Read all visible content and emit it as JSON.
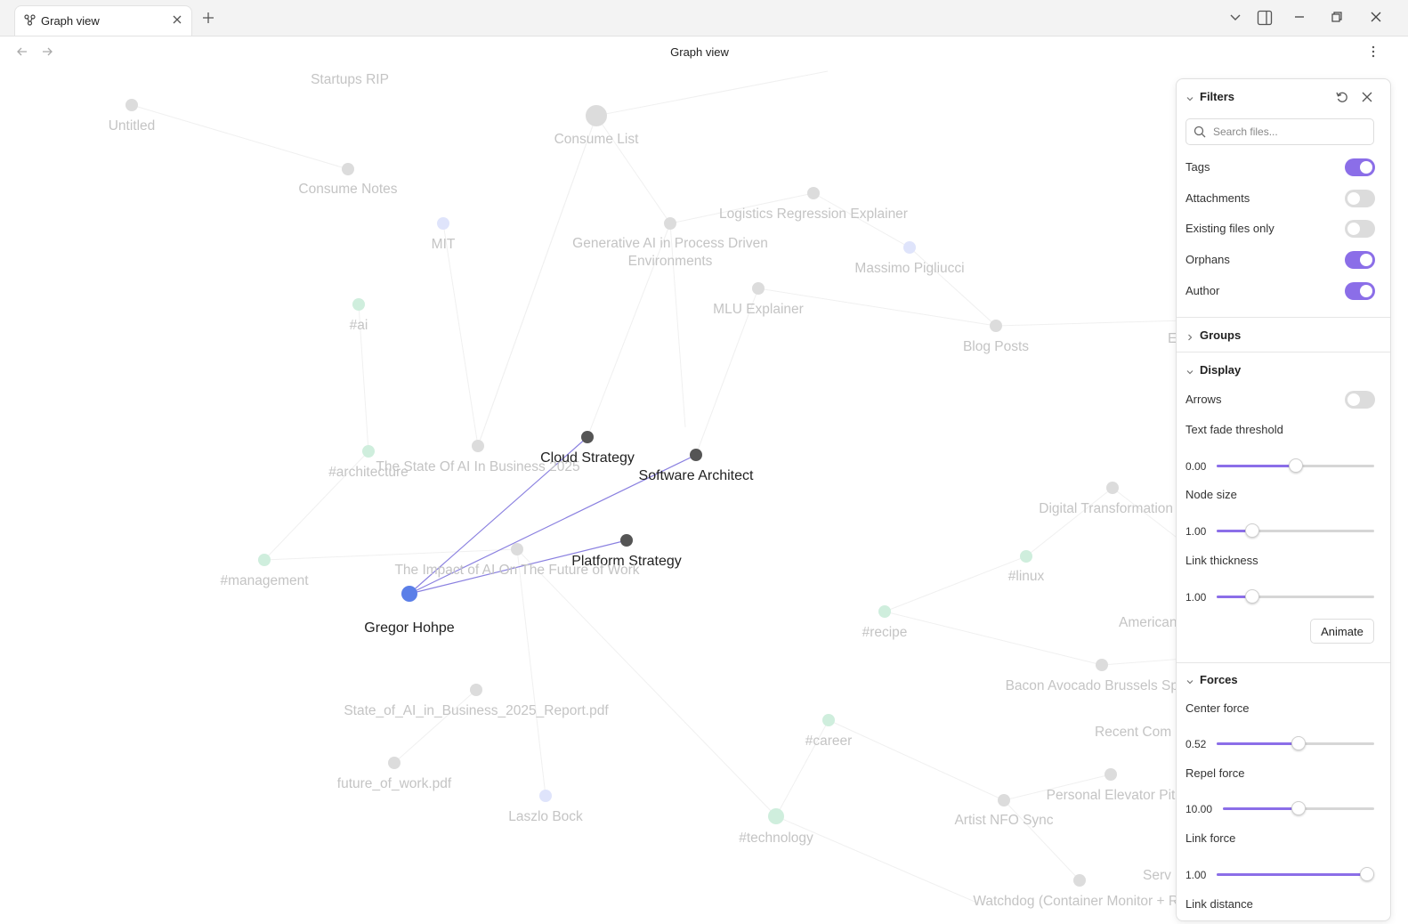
{
  "tab": {
    "label": "Graph view",
    "icon": "graph-icon"
  },
  "view_title": "Graph view",
  "graph": {
    "nodes": [
      {
        "label": "Startups RIP",
        "style": "faint"
      },
      {
        "label": "Untitled",
        "style": "faint"
      },
      {
        "label": "Consume List",
        "style": "faint"
      },
      {
        "label": "Consume Notes",
        "style": "faint"
      },
      {
        "label": "MIT",
        "style": "faint-blue"
      },
      {
        "label": "Generative AI in Process Driven",
        "style": "faint"
      },
      {
        "label": "Environments",
        "style": "faint"
      },
      {
        "label": "Logistics Regression Explainer",
        "style": "faint"
      },
      {
        "label": "Massimo Pigliucci",
        "style": "faint-blue"
      },
      {
        "label": "MLU Explainer",
        "style": "faint"
      },
      {
        "label": "#ai",
        "style": "faint-green"
      },
      {
        "label": "Blog Posts",
        "style": "faint"
      },
      {
        "label": "#architecture",
        "style": "faint-green"
      },
      {
        "label": "The State Of AI In Business 2025",
        "style": "faint"
      },
      {
        "label": "Cloud Strategy",
        "style": "active"
      },
      {
        "label": "Software Architect",
        "style": "active"
      },
      {
        "label": "Platform Strategy",
        "style": "active"
      },
      {
        "label": "#management",
        "style": "faint-green"
      },
      {
        "label": "The Impact of AI On The  Future of Work",
        "style": "faint"
      },
      {
        "label": "Gregor Hohpe",
        "style": "selected"
      },
      {
        "label": "Digital Transformation S",
        "style": "faint"
      },
      {
        "label": "#linux",
        "style": "faint-green"
      },
      {
        "label": "#recipe",
        "style": "faint-green"
      },
      {
        "label": "American",
        "style": "faint"
      },
      {
        "label": "Bacon Avocado Brussels Sprou",
        "style": "faint"
      },
      {
        "label": "State_of_AI_in_Business_2025_Report.pdf",
        "style": "faint"
      },
      {
        "label": "#career",
        "style": "faint-green"
      },
      {
        "label": "Recent Com",
        "style": "faint"
      },
      {
        "label": "future_of_work.pdf",
        "style": "faint"
      },
      {
        "label": "Laszlo Bock",
        "style": "faint-blue"
      },
      {
        "label": "#technology",
        "style": "faint-green"
      },
      {
        "label": "Artist NFO Sync",
        "style": "faint"
      },
      {
        "label": "Personal Elevator Pit",
        "style": "faint"
      },
      {
        "label": "Watchdog (Container Monitor + Re",
        "style": "faint"
      },
      {
        "label": "Serv",
        "style": "faint"
      },
      {
        "label": "E",
        "style": "faint"
      }
    ],
    "active_links": [
      [
        "Gregor Hohpe",
        "Cloud Strategy"
      ],
      [
        "Gregor Hohpe",
        "Software Architect"
      ],
      [
        "Gregor Hohpe",
        "Platform Strategy"
      ]
    ]
  },
  "filters_panel": {
    "filters": {
      "title": "Filters",
      "search_placeholder": "Search files...",
      "search_value": "",
      "toggles": [
        {
          "label": "Tags",
          "on": true
        },
        {
          "label": "Attachments",
          "on": false
        },
        {
          "label": "Existing files only",
          "on": false
        },
        {
          "label": "Orphans",
          "on": true
        },
        {
          "label": "Author",
          "on": true
        }
      ]
    },
    "groups": {
      "title": "Groups"
    },
    "display": {
      "title": "Display",
      "arrows": {
        "label": "Arrows",
        "on": false
      },
      "text_fade": {
        "label": "Text fade threshold",
        "display": "0.00",
        "fraction": 0.5
      },
      "node_size": {
        "label": "Node size",
        "display": "1.00",
        "fraction": 0.2
      },
      "link_thickness": {
        "label": "Link thickness",
        "display": "1.00",
        "fraction": 0.2
      },
      "animate_label": "Animate"
    },
    "forces": {
      "title": "Forces",
      "center_force": {
        "label": "Center force",
        "display": "0.52",
        "fraction": 0.52
      },
      "repel_force": {
        "label": "Repel force",
        "display": "10.00",
        "fraction": 0.5
      },
      "link_force": {
        "label": "Link force",
        "display": "1.00",
        "fraction": 1.0
      },
      "link_distance": {
        "label": "Link distance"
      }
    }
  },
  "colors": {
    "accent": "#8b6ee8",
    "selected_node": "#5b7fe8",
    "active_node": "#555555",
    "link": "#8a80e0"
  }
}
